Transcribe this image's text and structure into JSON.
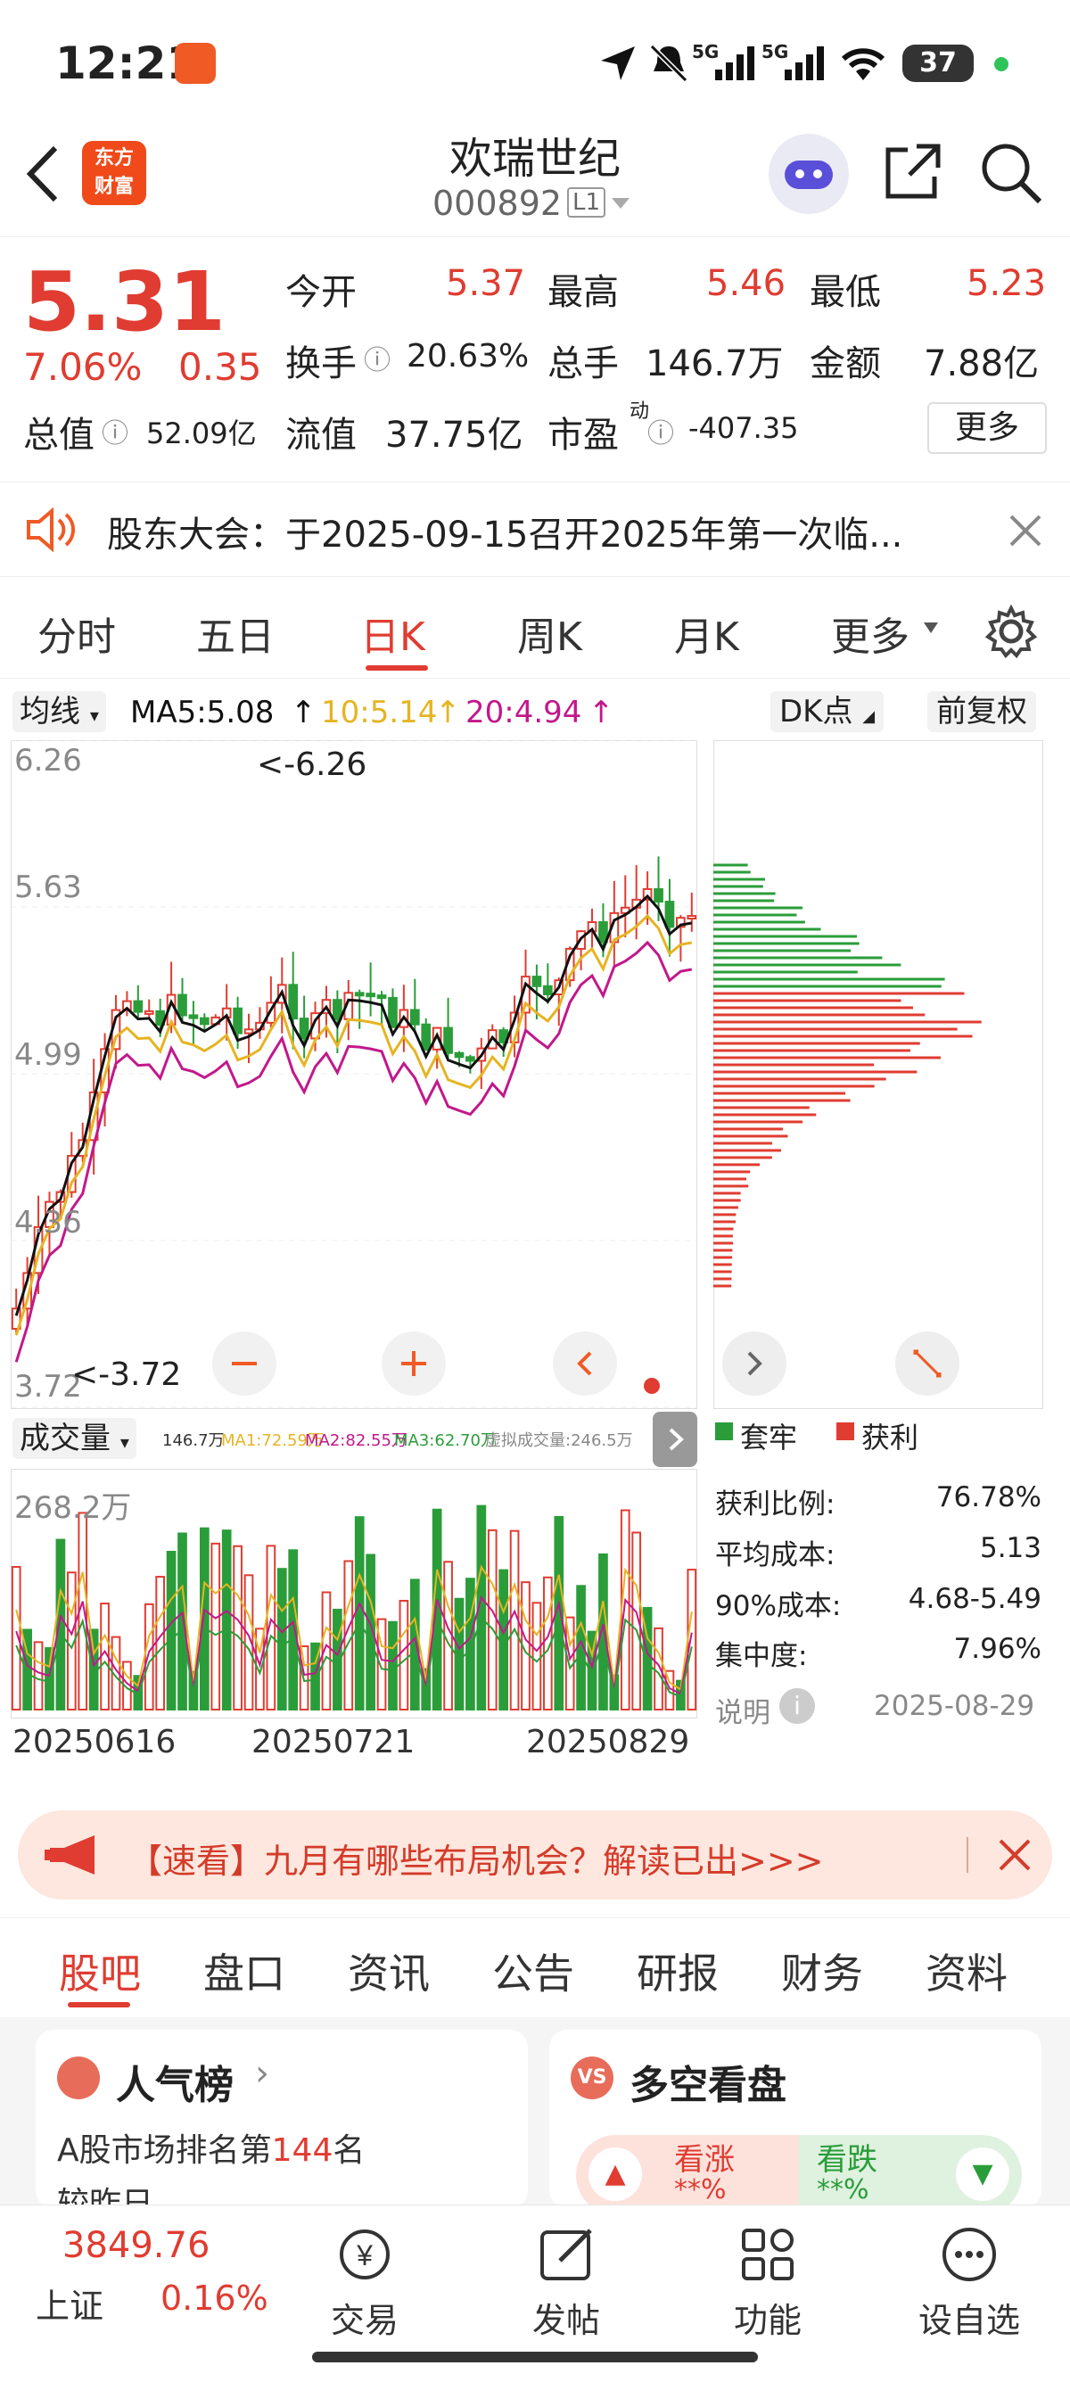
{
  "status_bar": {
    "time": "12:21",
    "battery": "37",
    "signal1": "5G",
    "signal2": "5G"
  },
  "header": {
    "app_logo": "东方\n财富",
    "stock_name": "欢瑞世纪",
    "stock_code": "000892",
    "level_badge": "L1"
  },
  "quote": {
    "price": "5.31",
    "change_pct": "7.06%",
    "change": "0.35",
    "open_label": "今开",
    "open": "5.37",
    "high_label": "最高",
    "high": "5.46",
    "low_label": "最低",
    "low": "5.23",
    "turnover_label": "换手",
    "turnover": "20.63%",
    "volume_label": "总手",
    "volume": "146.7万",
    "amount_label": "金额",
    "amount": "7.88亿",
    "mktcap_label": "总值",
    "mktcap": "52.09亿",
    "float_label": "流值",
    "float_cap": "37.75亿",
    "pe_label": "市盈",
    "pe_sup": "动",
    "pe": "-407.35",
    "more_button": "更多"
  },
  "notice": {
    "text": "股东大会：于2025-09-15召开2025年第一次临..."
  },
  "period_tabs": [
    {
      "label": "分时"
    },
    {
      "label": "五日"
    },
    {
      "label": "日K"
    },
    {
      "label": "周K"
    },
    {
      "label": "月K"
    },
    {
      "label": "更多"
    }
  ],
  "chart": {
    "ma_selector": "均线",
    "ma5": "MA5:5.08",
    "ma10": "10:5.14",
    "ma20": "20:4.94",
    "dk_button": "DK点",
    "adjust_button": "前复权",
    "y_labels": [
      "6.26",
      "5.63",
      "4.99",
      "4.36",
      "3.72"
    ],
    "max_marker": "<-6.26",
    "min_marker": "<-3.72",
    "volume_selector": "成交量",
    "volume_legend": {
      "vol": "146.7万",
      "ma1": "MA1:72.59万",
      "ma2": "MA2:82.55万",
      "ma3": "MA3:62.70万",
      "virtual": "虚拟成交量:246.5万"
    },
    "volume_max": "268.2万",
    "dates": [
      "20250616",
      "20250721",
      "20250829"
    ]
  },
  "chip": {
    "legend_trapped": "套牢",
    "legend_profit": "获利",
    "rows": [
      {
        "label": "获利比例:",
        "value": "76.78%"
      },
      {
        "label": "平均成本:",
        "value": "5.13"
      },
      {
        "label": "90%成本:",
        "value": "4.68-5.49"
      },
      {
        "label": "集中度:",
        "value": "7.96%"
      }
    ],
    "note_label": "说明",
    "date": "2025-08-29"
  },
  "banner": {
    "text": "【速看】九月有哪些布局机会？解读已出>>>"
  },
  "sub_tabs": [
    {
      "label": "股吧"
    },
    {
      "label": "盘口"
    },
    {
      "label": "资讯"
    },
    {
      "label": "公告"
    },
    {
      "label": "研报"
    },
    {
      "label": "财务"
    },
    {
      "label": "资料"
    }
  ],
  "cards": {
    "popularity_title": "人气榜",
    "popularity_rank_prefix": "A股市场排名第",
    "popularity_rank": "144",
    "popularity_rank_suffix": "名",
    "popularity_sub": "较昨日",
    "sentiment_title": "多空看盘",
    "bull_label": "看涨",
    "bear_label": "看跌",
    "bull_pct": "**%",
    "bear_pct": "**%"
  },
  "bottom_nav": {
    "index_value": "3849.76",
    "index_name": "上证",
    "index_change": "0.16%",
    "items": [
      {
        "label": "交易"
      },
      {
        "label": "发帖"
      },
      {
        "label": "功能"
      },
      {
        "label": "设自选"
      }
    ]
  },
  "colors": {
    "up": "#e03c31",
    "down": "#2a9d3a",
    "ma5": "#111111",
    "ma10": "#e6b422",
    "ma20": "#c2188b",
    "accent": "#f04a1a"
  }
}
